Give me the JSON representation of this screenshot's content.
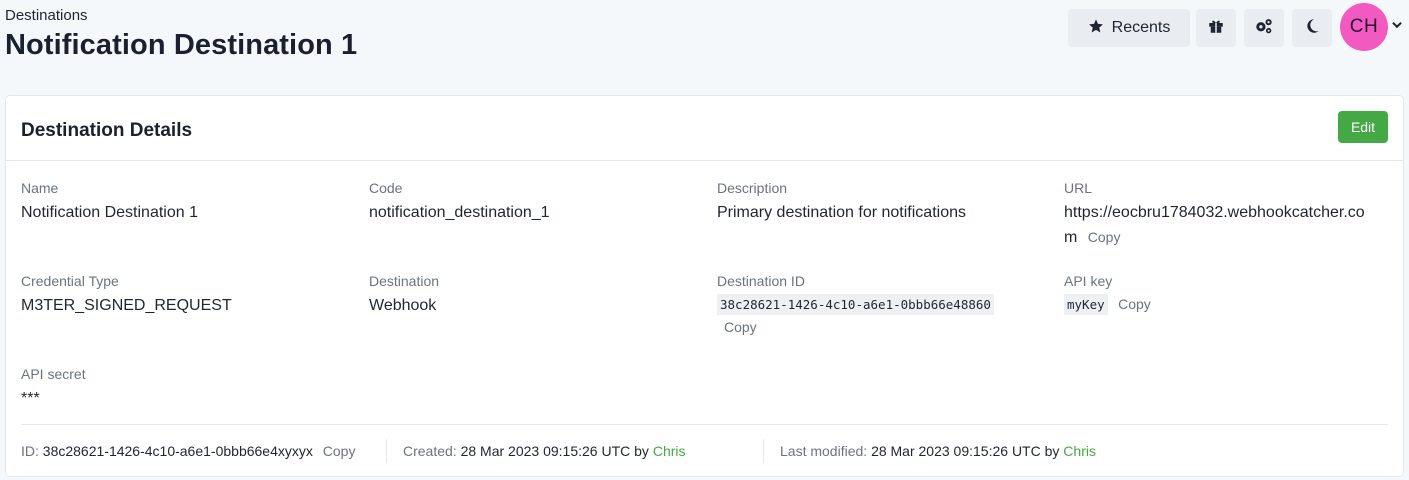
{
  "header": {
    "breadcrumb": "Destinations",
    "title": "Notification Destination 1",
    "recents_label": "Recents",
    "avatar_initials": "CH"
  },
  "card": {
    "title": "Destination Details",
    "edit_label": "Edit",
    "fields": {
      "name": {
        "label": "Name",
        "value": "Notification Destination 1"
      },
      "code": {
        "label": "Code",
        "value": "notification_destination_1"
      },
      "description": {
        "label": "Description",
        "value": "Primary destination for notifications"
      },
      "url": {
        "label": "URL",
        "value_line1": "https://eocbru1784032.webhookcatcher.co",
        "value_line2": "m",
        "copy": "Copy"
      },
      "credential_type": {
        "label": "Credential Type",
        "value": "M3TER_SIGNED_REQUEST"
      },
      "destination": {
        "label": "Destination",
        "value": "Webhook"
      },
      "destination_id": {
        "label": "Destination ID",
        "value": "38c28621-1426-4c10-a6e1-0bbb66e48860",
        "copy": "Copy"
      },
      "api_key": {
        "label": "API key",
        "value": "myKey",
        "copy": "Copy"
      },
      "api_secret": {
        "label": "API secret",
        "value": "***"
      }
    },
    "footer": {
      "id_label": "ID:",
      "id_value": "38c28621-1426-4c10-a6e1-0bbb66e4xyxyx",
      "copy": "Copy",
      "created_label": "Created:",
      "created_value": "28 Mar 2023 09:15:26 UTC by",
      "created_by": "Chris",
      "modified_label": "Last modified:",
      "modified_value": "28 Mar 2023 09:15:26 UTC by",
      "modified_by": "Chris"
    }
  },
  "colors": {
    "accent_green": "#44a845",
    "avatar_pink": "#f25ac2"
  },
  "icons": [
    "star-icon",
    "gift-icon",
    "gears-icon",
    "moon-icon",
    "chevron-down-icon"
  ]
}
